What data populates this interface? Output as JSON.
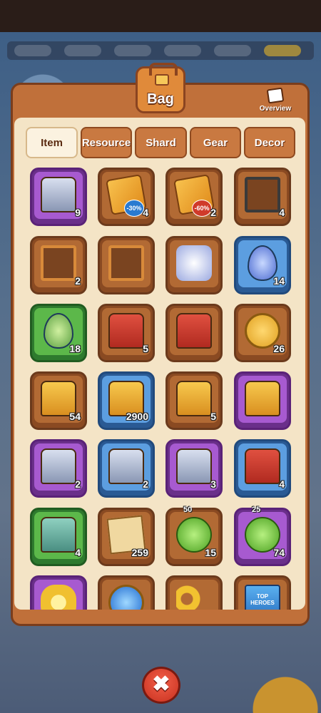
{
  "window": {
    "title": "Bag"
  },
  "header": {
    "overview_label": "Overview"
  },
  "tabs": [
    {
      "label": "Item",
      "active": true
    },
    {
      "label": "Resource",
      "active": false
    },
    {
      "label": "Shard",
      "active": false
    },
    {
      "label": "Gear",
      "active": false
    },
    {
      "label": "Decor",
      "active": false
    }
  ],
  "items": [
    {
      "icon": "silver-chest-icon",
      "rarity": "purple",
      "count": "9"
    },
    {
      "icon": "discount-ticket-icon",
      "rarity": "brown",
      "count": "4",
      "badge": "-30%"
    },
    {
      "icon": "discount-ticket-icon",
      "rarity": "brown",
      "count": "2",
      "badge": "-60%"
    },
    {
      "icon": "dark-frame-icon",
      "rarity": "brown",
      "count": "4"
    },
    {
      "icon": "avatar-frame-icon",
      "rarity": "brown",
      "count": "2"
    },
    {
      "icon": "star-frame-icon",
      "rarity": "brown",
      "count": ""
    },
    {
      "icon": "hero-portrait-icon",
      "rarity": "brown",
      "count": ""
    },
    {
      "icon": "blue-egg-icon",
      "rarity": "blue",
      "count": "14"
    },
    {
      "icon": "green-egg-icon",
      "rarity": "green",
      "count": "18"
    },
    {
      "icon": "red-chest-icon",
      "rarity": "brown",
      "count": "5"
    },
    {
      "icon": "red-chest-leaf-icon",
      "rarity": "brown",
      "count": ""
    },
    {
      "icon": "gold-coin-icon",
      "rarity": "brown",
      "count": "26"
    },
    {
      "icon": "gold-chest-icon",
      "rarity": "brown",
      "count": "54"
    },
    {
      "icon": "gem-chest-icon",
      "rarity": "blue",
      "count": "2900"
    },
    {
      "icon": "gold-chest-leaf-icon",
      "rarity": "brown",
      "count": "5"
    },
    {
      "icon": "treasure-chest-icon",
      "rarity": "purple",
      "count": ""
    },
    {
      "icon": "mystery-chest-icon",
      "rarity": "purple",
      "count": "2"
    },
    {
      "icon": "mystery-chest-icon",
      "rarity": "blue",
      "count": "2"
    },
    {
      "icon": "silver-chest-icon",
      "rarity": "purple",
      "count": "3"
    },
    {
      "icon": "bronze-chest-icon",
      "rarity": "blue",
      "count": "4"
    },
    {
      "icon": "green-chest-icon",
      "rarity": "green",
      "count": "4"
    },
    {
      "icon": "treasure-map-icon",
      "rarity": "brown",
      "count": "259"
    },
    {
      "icon": "energy-potion-icon",
      "rarity": "brown",
      "count": "15",
      "top": "50"
    },
    {
      "icon": "energy-potion-icon",
      "rarity": "purple",
      "count": "74",
      "top": "25"
    },
    {
      "icon": "flower-icon",
      "rarity": "purple",
      "count": ""
    },
    {
      "icon": "blue-orb-icon",
      "rarity": "brown",
      "count": ""
    },
    {
      "icon": "key-icon",
      "rarity": "brown",
      "count": ""
    },
    {
      "icon": "book-icon",
      "rarity": "brown",
      "count": "",
      "label": "TOP HEROES"
    }
  ],
  "close_label": "✖"
}
